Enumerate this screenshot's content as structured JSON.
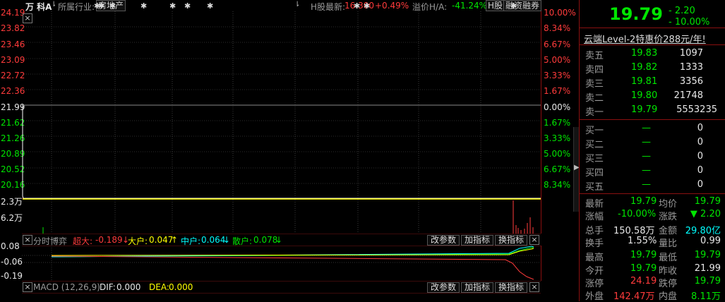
{
  "stock": {
    "name": "万 科A",
    "industry_label": "所属行业:",
    "industry_value": "房地产",
    "h_label": "H股最新:",
    "h_price": "16.300",
    "h_change": "+0.49%",
    "premium_label": "溢价H/A:",
    "premium_value": "-41.24%",
    "h_btn": "H股",
    "margin_btn": "融资融券"
  },
  "chart": {
    "y_left": [
      "24.19",
      "23.82",
      "23.46",
      "23.09",
      "22.72",
      "22.36",
      "21.99",
      "21.62",
      "21.26",
      "20.89",
      "20.52",
      "20.16"
    ],
    "y_right": [
      "10.00%",
      "8.34%",
      "6.67%",
      "5.00%",
      "3.33%",
      "1.67%",
      "0.00%",
      "1.67%",
      "3.33%",
      "5.00%",
      "6.67%",
      "8.34%"
    ],
    "vol_labels": [
      "2.3万",
      "6.2万"
    ],
    "close_btn": "×"
  },
  "indicator1": {
    "name": "分时博弈",
    "super_label": "超大:",
    "super_value": "-0.189",
    "big_label": "大户:",
    "big_value": "0.047",
    "mid_label": "中户:",
    "mid_value": "0.064",
    "small_label": "散户:",
    "small_value": "0.078",
    "y_labels": [
      "0.08",
      "-0.06",
      "-0.19"
    ]
  },
  "indicator2": {
    "name": "MACD (12,26,9)",
    "dif_label": "DIF:",
    "dif_value": "0.000",
    "dea_label": "DEA:",
    "dea_value": "0.000"
  },
  "buttons": {
    "modify": "改参数",
    "add": "加指标",
    "switch": "换指标",
    "close": "×"
  },
  "quote": {
    "price": "19.79",
    "change": "- 2.20",
    "pct": "- 10.00%",
    "promo": "云端Level-2特惠价288元/年!"
  },
  "orderbook": {
    "asks": [
      {
        "label": "卖五",
        "price": "19.83",
        "vol": "1097"
      },
      {
        "label": "卖四",
        "price": "19.82",
        "vol": "1333"
      },
      {
        "label": "卖三",
        "price": "19.81",
        "vol": "3356"
      },
      {
        "label": "卖二",
        "price": "19.80",
        "vol": "21748"
      },
      {
        "label": "卖一",
        "price": "19.79",
        "vol": "5553235"
      }
    ],
    "bids": [
      {
        "label": "买一",
        "price": "—",
        "vol": "0"
      },
      {
        "label": "买二",
        "price": "—",
        "vol": "0"
      },
      {
        "label": "买三",
        "price": "—",
        "vol": "0"
      },
      {
        "label": "买四",
        "price": "—",
        "vol": "0"
      },
      {
        "label": "买五",
        "price": "—",
        "vol": "0"
      }
    ]
  },
  "stats": [
    {
      "l1": "最新",
      "v1": "19.79",
      "c1": "green",
      "l2": "均价",
      "v2": "19.79",
      "c2": "green"
    },
    {
      "l1": "涨幅",
      "v1": "-10.00%",
      "c1": "green",
      "l2": "涨跌",
      "v2": "▼ 2.20",
      "c2": "green"
    },
    {
      "l1": "总手",
      "v1": "150.58万",
      "c1": "white",
      "l2": "金额",
      "v2": "29.80亿",
      "c2": "cyan"
    },
    {
      "l1": "换手",
      "v1": "1.55%",
      "c1": "white",
      "l2": "量比",
      "v2": "0.99",
      "c2": "white"
    },
    {
      "l1": "最高",
      "v1": "19.79",
      "c1": "green",
      "l2": "最低",
      "v2": "19.79",
      "c2": "green"
    },
    {
      "l1": "今开",
      "v1": "19.79",
      "c1": "green",
      "l2": "昨收",
      "v2": "21.99",
      "c2": "white"
    },
    {
      "l1": "涨停",
      "v1": "24.19",
      "c1": "red",
      "l2": "跌停",
      "v2": "19.79",
      "c2": "green"
    },
    {
      "l1": "外盘",
      "v1": "142.47万",
      "c1": "red",
      "l2": "内盘",
      "v2": "8.11万",
      "c2": "green"
    }
  ]
}
